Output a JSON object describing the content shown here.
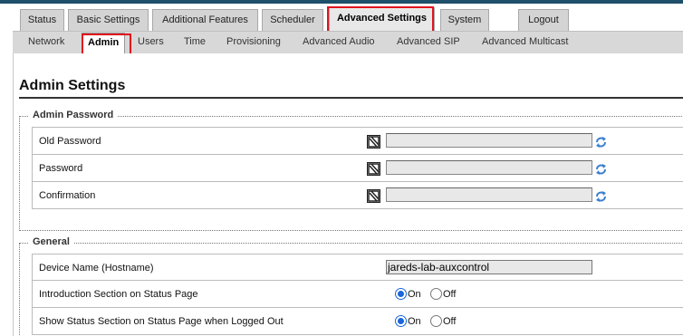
{
  "main_tabs": [
    "Status",
    "Basic Settings",
    "Additional Features",
    "Scheduler",
    "Advanced Settings",
    "System",
    "Logout"
  ],
  "sub_tabs": [
    "Network",
    "Admin",
    "Users",
    "Time",
    "Provisioning",
    "Advanced Audio",
    "Advanced SIP",
    "Advanced Multicast"
  ],
  "page_title": "Admin Settings",
  "admin_password": {
    "legend": "Admin Password",
    "rows": [
      {
        "label": "Old Password",
        "value": ""
      },
      {
        "label": "Password",
        "value": ""
      },
      {
        "label": "Confirmation",
        "value": ""
      }
    ]
  },
  "general": {
    "legend": "General",
    "hostname_label": "Device Name (Hostname)",
    "hostname_value": "jareds-lab-auxcontrol",
    "rows": [
      {
        "label": "Introduction Section on Status Page",
        "on": "On",
        "off": "Off",
        "selected": "On"
      },
      {
        "label": "Show Status Section on Status Page when Logged Out",
        "on": "On",
        "off": "Off",
        "selected": "On"
      }
    ]
  },
  "colors": {
    "highlight": "#e0141e",
    "radio_accent": "#1a66d9",
    "top_stripe": "#1e4f6b"
  },
  "icons": [
    "password-strength-icon",
    "refresh-icon"
  ]
}
